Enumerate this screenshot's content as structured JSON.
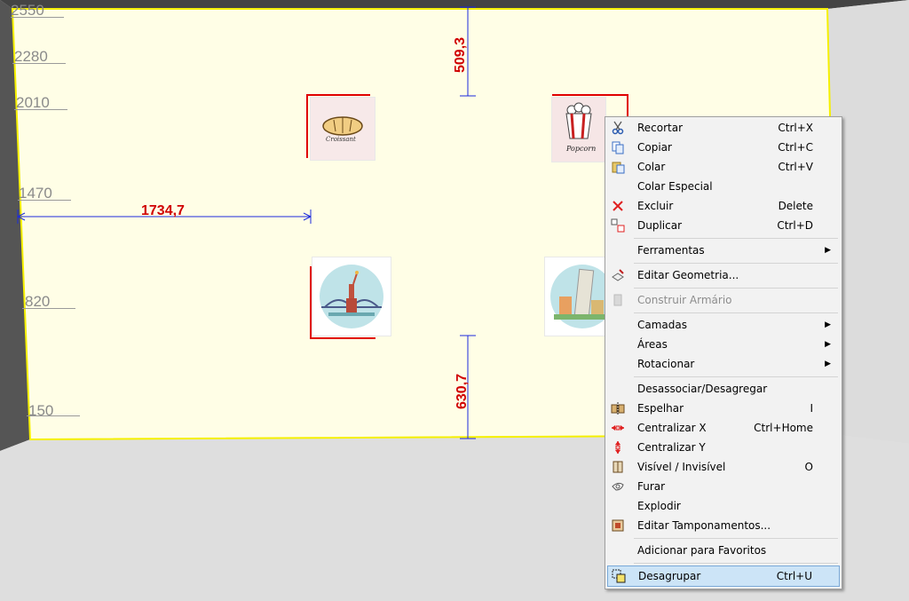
{
  "ruler_labels": [
    "2550",
    "2280",
    "2010",
    "1470",
    "820",
    "150"
  ],
  "dimensions": {
    "horizontal": "1734,7",
    "top_vertical": "509,3",
    "bottom_vertical": "630,7"
  },
  "pictures": {
    "croissant_text": "Croissant",
    "popcorn_text": "Popcorn"
  },
  "menu": {
    "items": [
      {
        "label": "Recortar",
        "shortcut": "Ctrl+X",
        "icon": "scissors-icon"
      },
      {
        "label": "Copiar",
        "shortcut": "Ctrl+C",
        "icon": "copy-icon"
      },
      {
        "label": "Colar",
        "shortcut": "Ctrl+V",
        "icon": "paste-icon"
      },
      {
        "label": "Colar Especial",
        "shortcut": "",
        "icon": ""
      },
      {
        "label": "Excluir",
        "shortcut": "Delete",
        "icon": "delete-x-icon"
      },
      {
        "label": "Duplicar",
        "shortcut": "Ctrl+D",
        "icon": "duplicate-icon"
      },
      {
        "label": "Ferramentas",
        "shortcut": "",
        "icon": "",
        "submenu": true
      },
      {
        "label": "Editar Geometria...",
        "shortcut": "",
        "icon": "edit-geometry-icon"
      },
      {
        "label": "Construir Armário",
        "shortcut": "",
        "icon": "cabinet-icon",
        "disabled": true
      },
      {
        "label": "Camadas",
        "shortcut": "",
        "icon": "",
        "submenu": true
      },
      {
        "label": "Áreas",
        "shortcut": "",
        "icon": "",
        "submenu": true
      },
      {
        "label": "Rotacionar",
        "shortcut": "",
        "icon": "",
        "submenu": true
      },
      {
        "label": "Desassociar/Desagregar",
        "shortcut": "",
        "icon": ""
      },
      {
        "label": "Espelhar",
        "shortcut": "I",
        "icon": "mirror-icon"
      },
      {
        "label": "Centralizar X",
        "shortcut": "Ctrl+Home",
        "icon": "center-x-icon"
      },
      {
        "label": "Centralizar Y",
        "shortcut": "",
        "icon": "center-y-icon"
      },
      {
        "label": "Visível / Invisível",
        "shortcut": "O",
        "icon": "visibility-icon"
      },
      {
        "label": "Furar",
        "shortcut": "",
        "icon": "drill-icon"
      },
      {
        "label": "Explodir",
        "shortcut": "",
        "icon": ""
      },
      {
        "label": "Editar Tamponamentos...",
        "shortcut": "",
        "icon": "edit-panels-icon"
      },
      {
        "label": "Adicionar para Favoritos",
        "shortcut": "",
        "icon": ""
      },
      {
        "label": "Desagrupar",
        "shortcut": "Ctrl+U",
        "icon": "ungroup-icon",
        "highlighted": true
      }
    ]
  },
  "colors": {
    "wall": "#fffee6",
    "wall_border": "#f5f000",
    "dimension": "#d00000",
    "menu_highlight": "#cce4f7"
  }
}
